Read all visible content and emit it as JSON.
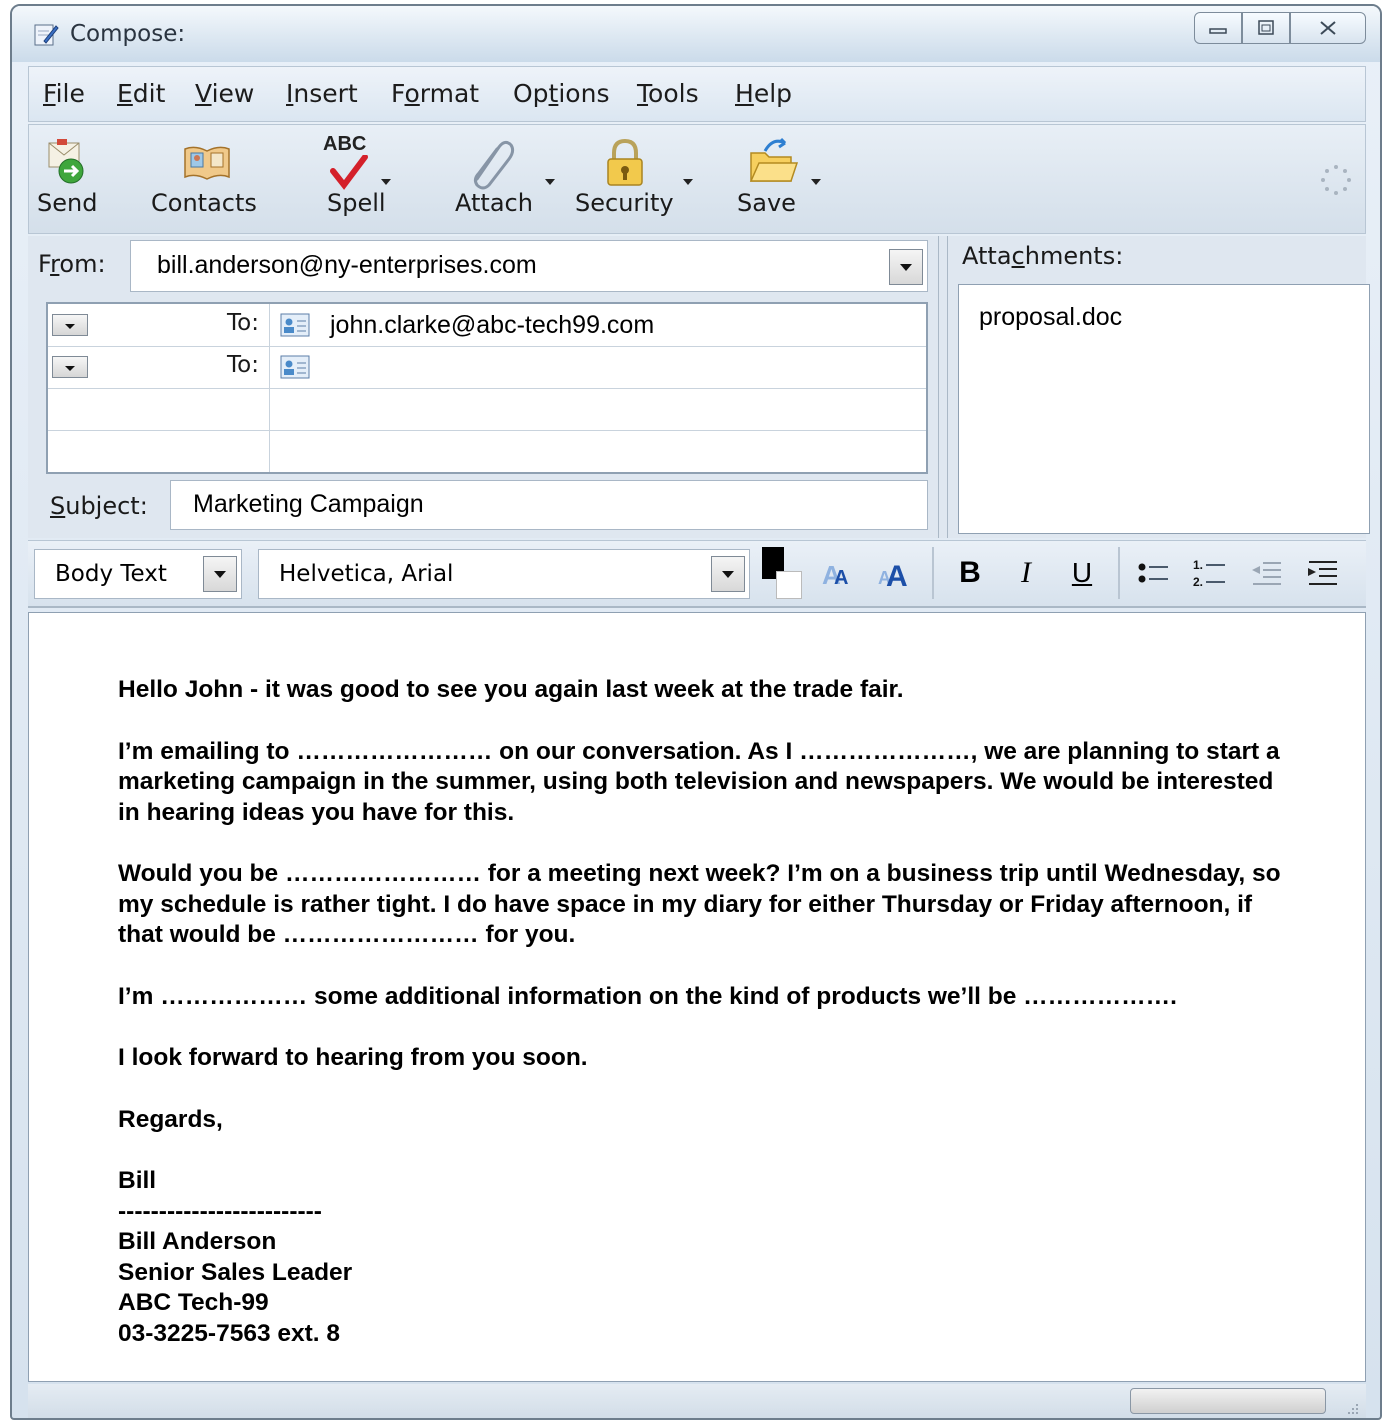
{
  "window": {
    "title": "Compose:",
    "accent": "#dbe6f1"
  },
  "menubar": {
    "items": [
      {
        "pre": "",
        "key": "F",
        "post": "ile"
      },
      {
        "pre": "",
        "key": "E",
        "post": "dit"
      },
      {
        "pre": "",
        "key": "V",
        "post": "iew"
      },
      {
        "pre": "",
        "key": "I",
        "post": "nsert"
      },
      {
        "pre": "F",
        "key": "o",
        "post": "rmat"
      },
      {
        "pre": "Op",
        "key": "t",
        "post": "ions"
      },
      {
        "pre": "",
        "key": "T",
        "post": "ools"
      },
      {
        "pre": "",
        "key": "H",
        "post": "elp"
      }
    ]
  },
  "toolbar": {
    "send": "Send",
    "contacts": "Contacts",
    "spell": "Spell",
    "spell_icon_text": "ABC",
    "attach": "Attach",
    "security": "Security",
    "save": "Save"
  },
  "header": {
    "from_label_pre": "F",
    "from_label_key": "r",
    "from_label_post": "om:",
    "from_value": "bill.anderson@ny-enterprises.com",
    "recipients": [
      {
        "type": "To:",
        "value": "john.clarke@abc-tech99.com"
      },
      {
        "type": "To:",
        "value": ""
      }
    ],
    "subject_label_key": "S",
    "subject_label_post": "ubject:",
    "subject_value": "Marketing Campaign",
    "attachments_label_pre": "Atta",
    "attachments_label_key": "c",
    "attachments_label_post": "hments:",
    "attachments": [
      "proposal.doc"
    ]
  },
  "format": {
    "paragraph_style": "Body Text",
    "font": "Helvetica, Arial",
    "text_color": "#000000",
    "bold": "B",
    "italic": "I",
    "underline": "U"
  },
  "body": {
    "paragraphs": [
      "Hello John - it was good to see you again last week at the trade fair.",
      "I’m emailing to …………………… on our conversation. As I …………………, we are planning to start a marketing campaign in the summer, using both television and newspapers. We would be interested in hearing ideas you have for this.",
      "Would you be …………………… for a meeting next week? I’m on a business trip until Wednesday, so my schedule is rather tight. I do have space in my diary for either Thursday or Friday afternoon, if that would be …………………… for you.",
      "I’m ……………… some additional information on the kind of products we’ll be ……………….",
      "I look forward to hearing from you soon.",
      "Regards,",
      "Bill"
    ],
    "signature": [
      "-------------------------",
      "Bill Anderson",
      "Senior Sales Leader",
      "ABC Tech-99",
      "03-3225-7563 ext. 8"
    ]
  }
}
